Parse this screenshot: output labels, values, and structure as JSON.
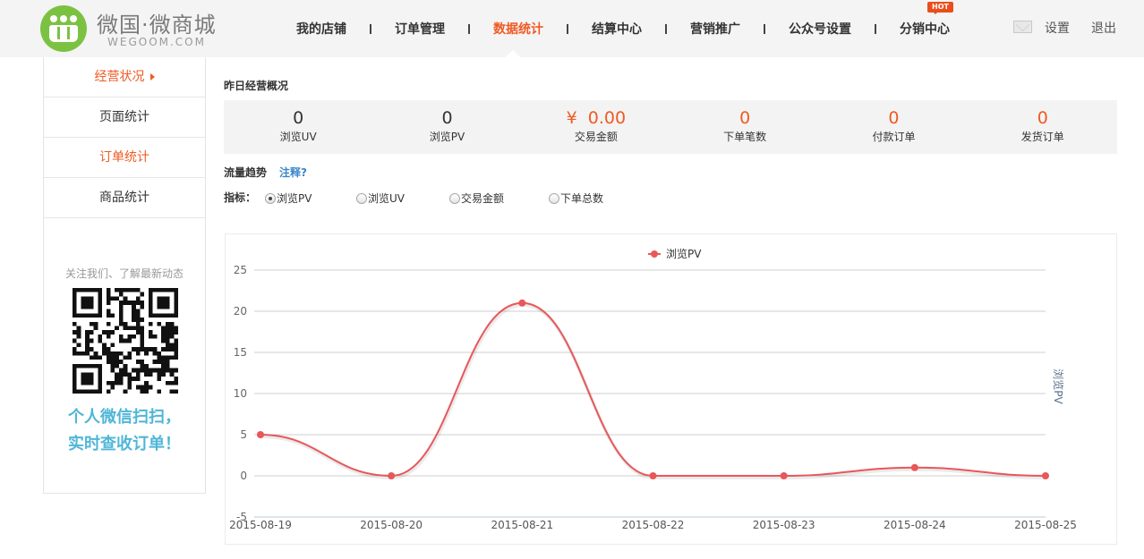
{
  "brand": {
    "title": "微国·微商城",
    "subtitle": "WEGOOM.COM",
    "color": "#7cc242"
  },
  "nav": {
    "items": [
      {
        "label": "我的店铺",
        "active": false
      },
      {
        "label": "订单管理",
        "active": false
      },
      {
        "label": "数据统计",
        "active": true
      },
      {
        "label": "结算中心",
        "active": false
      },
      {
        "label": "营销推广",
        "active": false
      },
      {
        "label": "公众号设置",
        "active": false
      },
      {
        "label": "分销中心",
        "active": false,
        "badge": "HOT"
      }
    ],
    "settings": "设置",
    "logout": "退出",
    "accent": "#f05a24"
  },
  "sidebar": {
    "items": [
      {
        "label": "经营状况",
        "active": true
      },
      {
        "label": "页面统计",
        "active": false
      },
      {
        "label": "订单统计",
        "active": true
      },
      {
        "label": "商品统计",
        "active": false
      }
    ],
    "follow_text": "关注我们、了解最新动态",
    "scan_line1": "个人微信扫扫，",
    "scan_line2": "实时查收订单！"
  },
  "overview": {
    "title": "昨日经营概况",
    "stats": [
      {
        "value": "0",
        "label": "浏览UV"
      },
      {
        "value": "0",
        "label": "浏览PV"
      },
      {
        "value": "¥  0.00",
        "label": "交易金额"
      },
      {
        "value": "0",
        "label": "下单笔数"
      },
      {
        "value": "0",
        "label": "付款订单"
      },
      {
        "value": "0",
        "label": "发货订单"
      }
    ]
  },
  "trend": {
    "title": "流量趋势",
    "note_link": "注释?",
    "indicator_label": "指标：",
    "options": [
      {
        "label": "浏览PV",
        "checked": true
      },
      {
        "label": "浏览UV",
        "checked": false
      },
      {
        "label": "交易金额",
        "checked": false
      },
      {
        "label": "下单总数",
        "checked": false
      }
    ]
  },
  "chart_data": {
    "type": "line",
    "title": "",
    "x": [
      "2015-08-19",
      "2015-08-20",
      "2015-08-21",
      "2015-08-22",
      "2015-08-23",
      "2015-08-24",
      "2015-08-25"
    ],
    "series": [
      {
        "name": "浏览PV",
        "values": [
          5,
          0,
          21,
          0,
          0,
          1,
          0
        ],
        "color": "#e8575a"
      }
    ],
    "ylabel": "浏览PV",
    "xlabel": "",
    "ylim": [
      -5,
      25
    ],
    "yticks": [
      -5,
      0,
      5,
      10,
      15,
      20,
      25
    ],
    "grid": true,
    "smooth": true,
    "legend": "top-center"
  }
}
